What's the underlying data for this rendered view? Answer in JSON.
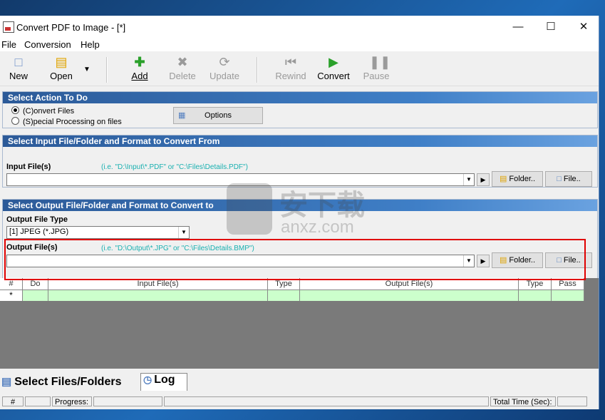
{
  "window": {
    "title": "Convert PDF to Image - [*]"
  },
  "menu": [
    "File",
    "Conversion",
    "Help"
  ],
  "toolbar": {
    "new": "New",
    "open": "Open",
    "add": "Add",
    "delete": "Delete",
    "update": "Update",
    "rewind": "Rewind",
    "convert": "Convert",
    "pause": "Pause"
  },
  "action": {
    "header": "Select Action To Do",
    "convert_files": "(C)onvert Files",
    "special": "(S)pecial Processing on files",
    "options": "Options"
  },
  "input": {
    "header": "Select Input File/Folder and Format to Convert From",
    "label": "Input File(s)",
    "hint": "(i.e. \"D:\\Input\\*.PDF\"  or \"C:\\Files\\Details.PDF\")",
    "value": "",
    "folder": "Folder..",
    "file": "File.."
  },
  "output": {
    "header": "Select Output File/Folder and Format to Convert to",
    "type_label": "Output File Type",
    "type_value": "[1] JPEG (*.JPG)",
    "label": "Output File(s)",
    "hint": "(i.e. \"D:\\Output\\*.JPG\"  or \"C:\\Files\\Details.BMP\")",
    "value": "",
    "folder": "Folder..",
    "file": "File.."
  },
  "grid": {
    "columns": [
      "#",
      "Do",
      "Input File(s)",
      "Type",
      "Output File(s)",
      "Type",
      "Pass"
    ],
    "row_marker": "*"
  },
  "tabs": {
    "files": "Select Files/Folders",
    "log": "Log"
  },
  "status": {
    "hash": "#",
    "progress": "Progress:",
    "total_time": "Total Time (Sec):"
  },
  "watermark": {
    "text_cn": "安下载",
    "text_en": "anxz.com"
  },
  "colors": {
    "accent_red": "#e00000",
    "section_blue": "#2c5a98",
    "hint_teal": "#19b0b0",
    "row_green": "#ccffcc"
  }
}
